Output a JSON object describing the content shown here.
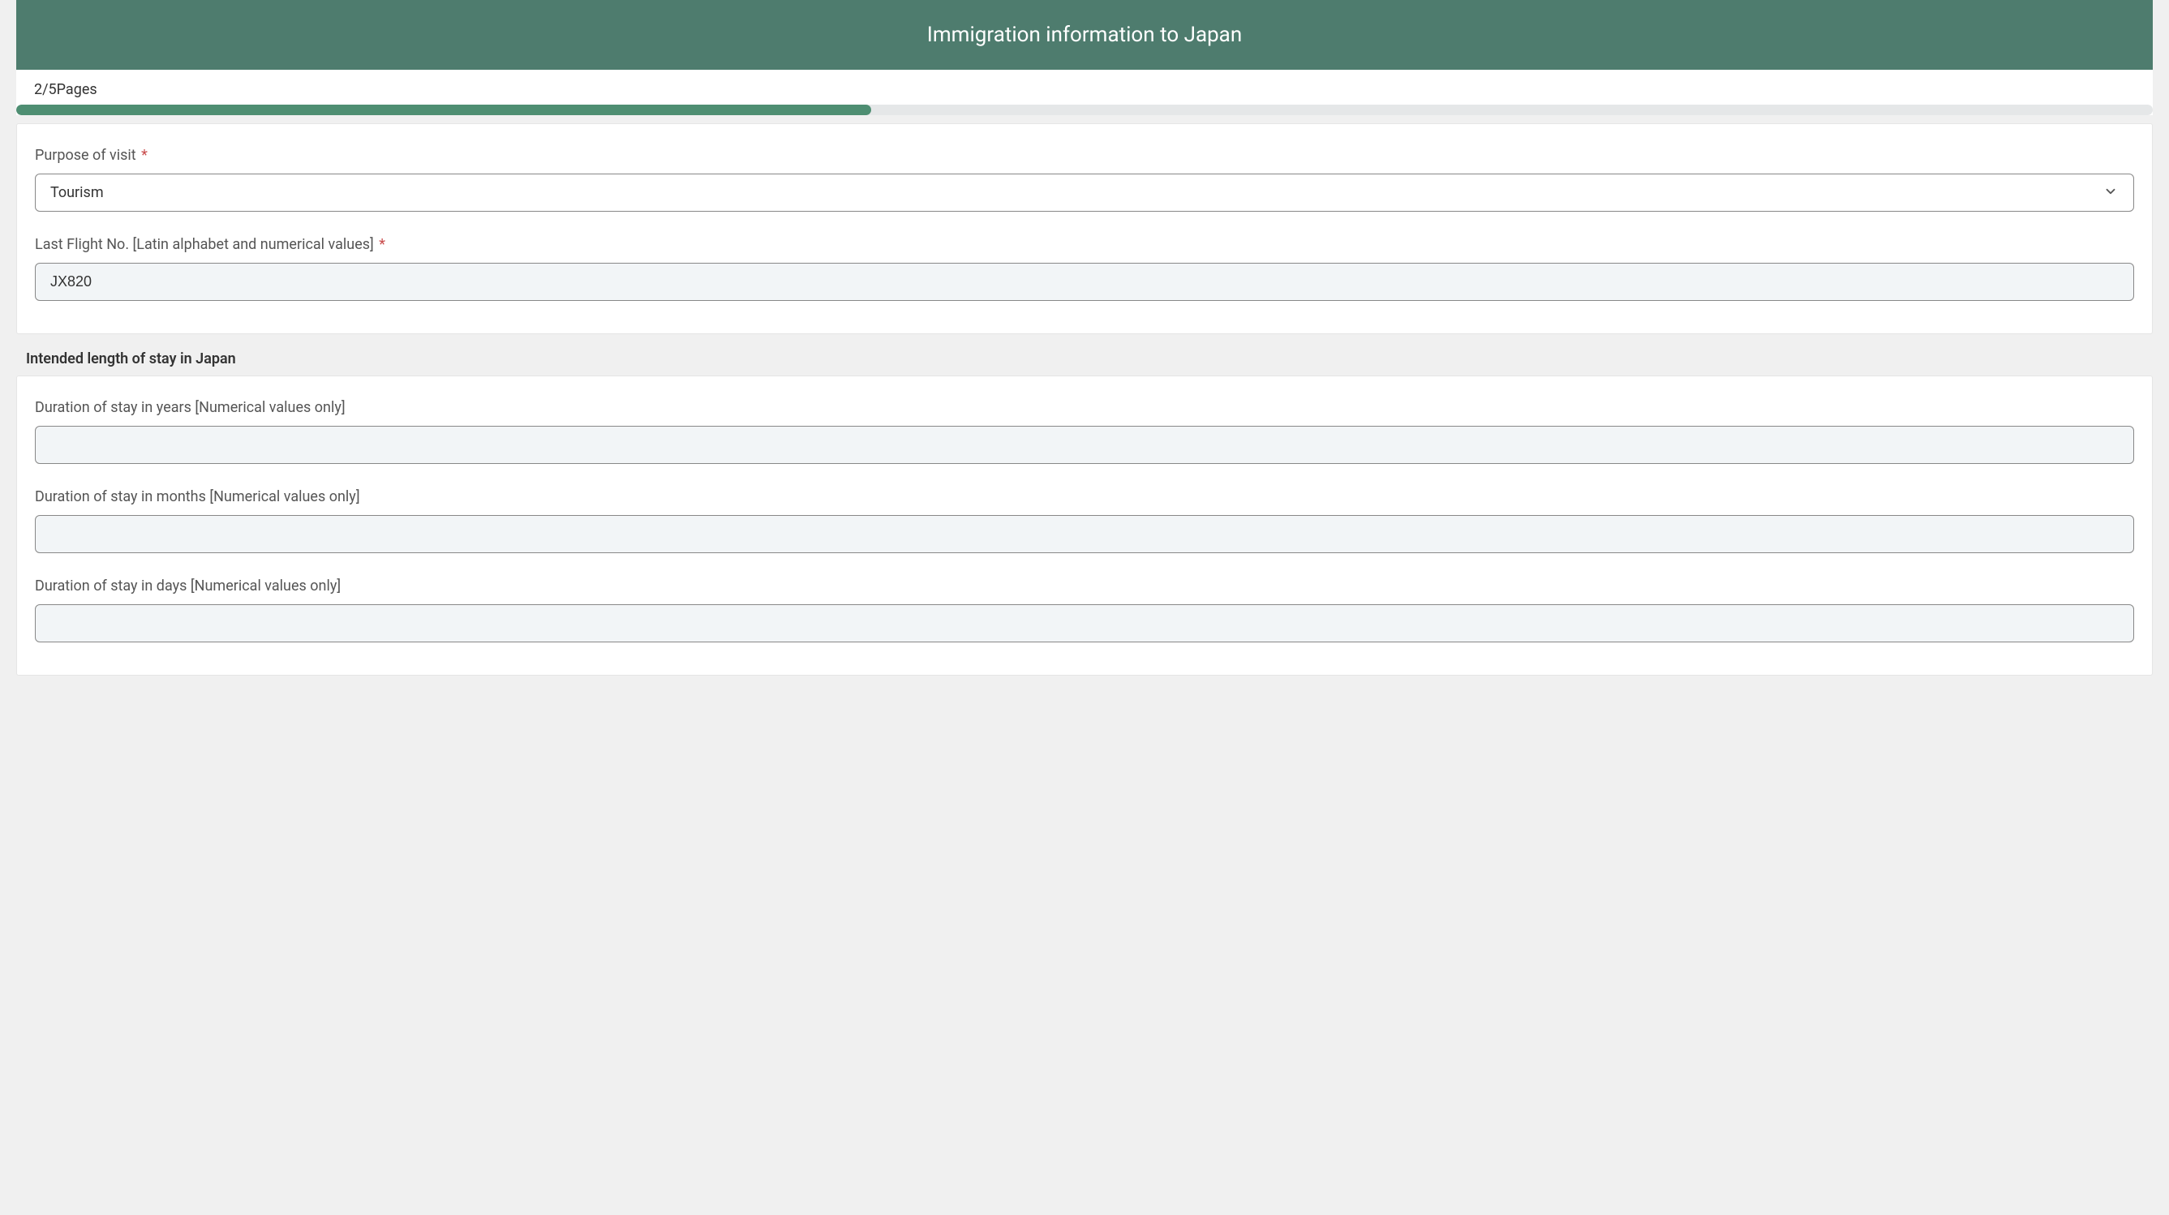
{
  "header": {
    "title": "Immigration information to Japan"
  },
  "progress": {
    "text": "2/5Pages",
    "percent": 40
  },
  "section1": {
    "purpose": {
      "label": "Purpose of visit",
      "required": true,
      "value": "Tourism"
    },
    "flight": {
      "label": "Last Flight No. [Latin alphabet and numerical values]",
      "required": true,
      "value": "JX820"
    }
  },
  "section2": {
    "heading": "Intended length of stay in Japan",
    "years": {
      "label": "Duration of stay in years [Numerical values only]",
      "value": ""
    },
    "months": {
      "label": "Duration of stay in months [Numerical values only]",
      "value": ""
    },
    "days": {
      "label": "Duration of stay in days [Numerical values only]",
      "value": ""
    }
  }
}
